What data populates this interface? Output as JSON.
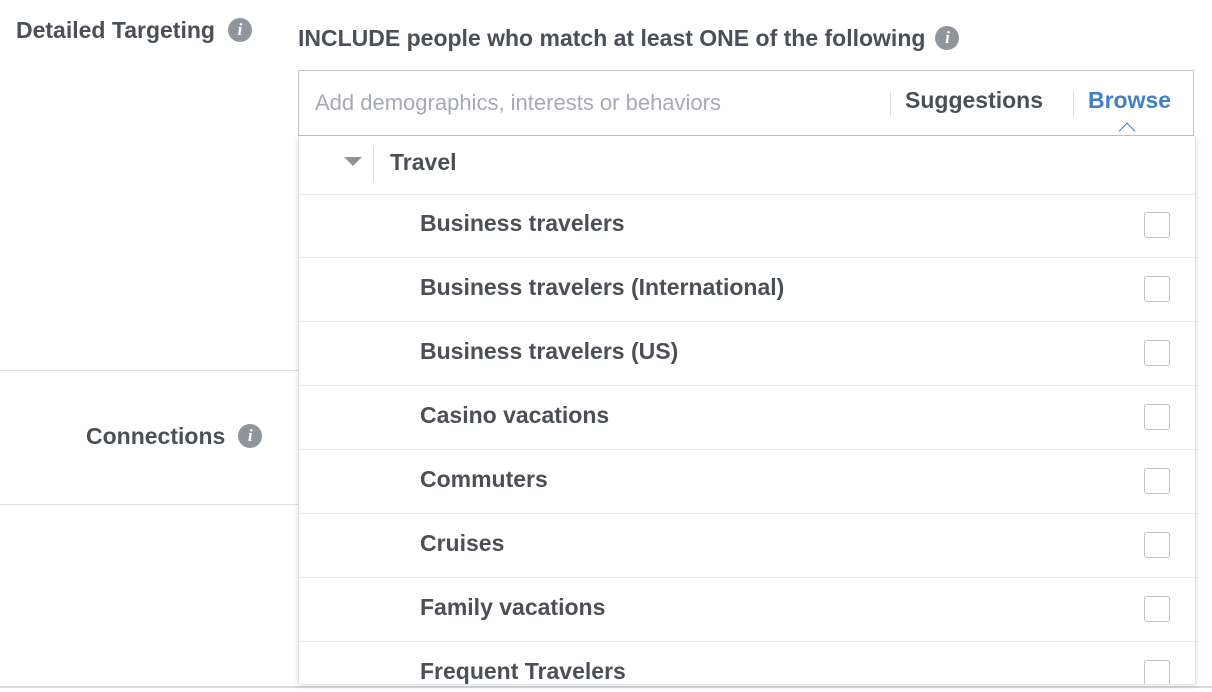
{
  "detailed_targeting": {
    "label": "Detailed Targeting",
    "info_icon": "info-icon"
  },
  "connections": {
    "label": "Connections",
    "info_icon": "info-icon"
  },
  "include": {
    "header": "INCLUDE people who match at least ONE of the following",
    "info_icon": "info-icon"
  },
  "search": {
    "placeholder": "Add demographics, interests or behaviors",
    "value": "",
    "suggestions_label": "Suggestions",
    "browse_label": "Browse",
    "active_tab": "Browse",
    "accent_color": "#4080c9"
  },
  "dropdown": {
    "category": {
      "label": "Travel",
      "expanded": true,
      "toggle_icon": "triangle-down-icon"
    },
    "items": [
      {
        "label": "Business travelers",
        "checked": false
      },
      {
        "label": "Business travelers (International)",
        "checked": false
      },
      {
        "label": "Business travelers (US)",
        "checked": false
      },
      {
        "label": "Casino vacations",
        "checked": false
      },
      {
        "label": "Commuters",
        "checked": false
      },
      {
        "label": "Cruises",
        "checked": false
      },
      {
        "label": "Family vacations",
        "checked": false
      },
      {
        "label": "Frequent Travelers",
        "checked": false
      }
    ]
  },
  "icon_text": "i"
}
